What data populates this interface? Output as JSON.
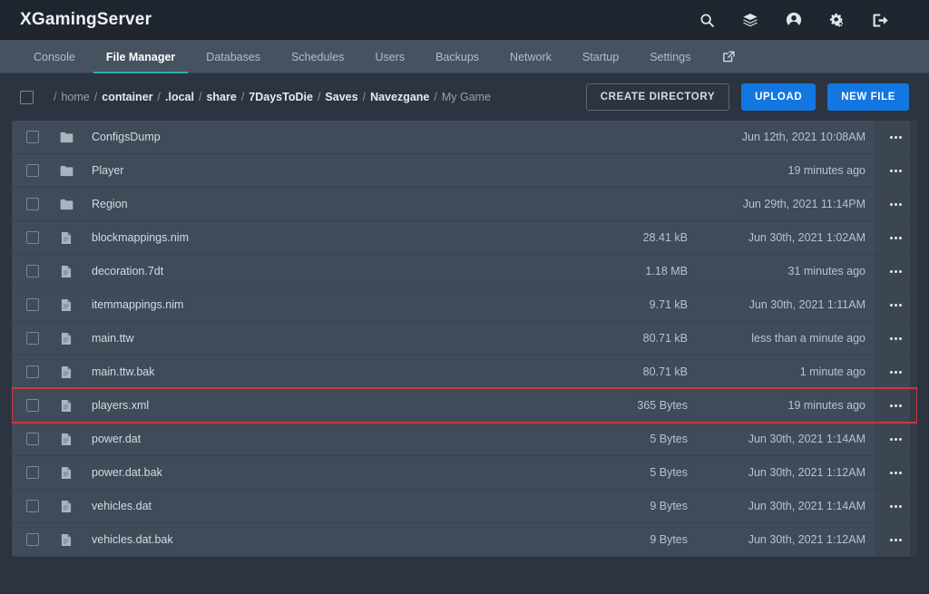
{
  "header": {
    "brand": "XGamingServer",
    "icons": [
      {
        "name": "search-icon",
        "label": "Search"
      },
      {
        "name": "layers-icon",
        "label": "Servers"
      },
      {
        "name": "user-circle-icon",
        "label": "Account"
      },
      {
        "name": "cogs-icon",
        "label": "Admin"
      },
      {
        "name": "sign-out-icon",
        "label": "Logout"
      }
    ]
  },
  "nav": {
    "tabs": [
      {
        "label": "Console",
        "active": false
      },
      {
        "label": "File Manager",
        "active": true
      },
      {
        "label": "Databases",
        "active": false
      },
      {
        "label": "Schedules",
        "active": false
      },
      {
        "label": "Users",
        "active": false
      },
      {
        "label": "Backups",
        "active": false
      },
      {
        "label": "Network",
        "active": false
      },
      {
        "label": "Startup",
        "active": false
      },
      {
        "label": "Settings",
        "active": false
      }
    ],
    "external_link_icon": "external-link-icon",
    "active_underline_color": "#2eada8"
  },
  "breadcrumb": {
    "segments": [
      {
        "label": "home",
        "dim": true
      },
      {
        "label": "container",
        "dim": false
      },
      {
        "label": ".local",
        "dim": false
      },
      {
        "label": "share",
        "dim": false
      },
      {
        "label": "7DaysToDie",
        "dim": false
      },
      {
        "label": "Saves",
        "dim": false
      },
      {
        "label": "Navezgane",
        "dim": false
      },
      {
        "label": "My Game",
        "dim": true
      }
    ],
    "separator": "/"
  },
  "toolbar": {
    "create_directory_label": "CREATE DIRECTORY",
    "upload_label": "UPLOAD",
    "new_file_label": "NEW FILE",
    "primary_color": "#1277e0"
  },
  "files": {
    "rows": [
      {
        "name": "ConfigsDump",
        "type": "folder",
        "size": "",
        "modified": "Jun 12th, 2021 10:08AM",
        "highlighted": false
      },
      {
        "name": "Player",
        "type": "folder",
        "size": "",
        "modified": "19 minutes ago",
        "highlighted": false
      },
      {
        "name": "Region",
        "type": "folder",
        "size": "",
        "modified": "Jun 29th, 2021 11:14PM",
        "highlighted": false
      },
      {
        "name": "blockmappings.nim",
        "type": "file",
        "size": "28.41 kB",
        "modified": "Jun 30th, 2021 1:02AM",
        "highlighted": false
      },
      {
        "name": "decoration.7dt",
        "type": "file",
        "size": "1.18 MB",
        "modified": "31 minutes ago",
        "highlighted": false
      },
      {
        "name": "itemmappings.nim",
        "type": "file",
        "size": "9.71 kB",
        "modified": "Jun 30th, 2021 1:11AM",
        "highlighted": false
      },
      {
        "name": "main.ttw",
        "type": "file",
        "size": "80.71 kB",
        "modified": "less than a minute ago",
        "highlighted": false
      },
      {
        "name": "main.ttw.bak",
        "type": "file",
        "size": "80.71 kB",
        "modified": "1 minute ago",
        "highlighted": false
      },
      {
        "name": "players.xml",
        "type": "file",
        "size": "365 Bytes",
        "modified": "19 minutes ago",
        "highlighted": true
      },
      {
        "name": "power.dat",
        "type": "file",
        "size": "5 Bytes",
        "modified": "Jun 30th, 2021 1:14AM",
        "highlighted": false
      },
      {
        "name": "power.dat.bak",
        "type": "file",
        "size": "5 Bytes",
        "modified": "Jun 30th, 2021 1:12AM",
        "highlighted": false
      },
      {
        "name": "vehicles.dat",
        "type": "file",
        "size": "9 Bytes",
        "modified": "Jun 30th, 2021 1:14AM",
        "highlighted": false
      },
      {
        "name": "vehicles.dat.bak",
        "type": "file",
        "size": "9 Bytes",
        "modified": "Jun 30th, 2021 1:12AM",
        "highlighted": false
      }
    ],
    "row_menu_icon": "ellipsis-icon",
    "highlight_color": "#d3353d"
  },
  "colors": {
    "page_background": "#2b3440",
    "topbar_background": "#1f252e",
    "navbar_background": "#46525f",
    "row_background": "#3f4b58",
    "accent": "#2eada8"
  }
}
